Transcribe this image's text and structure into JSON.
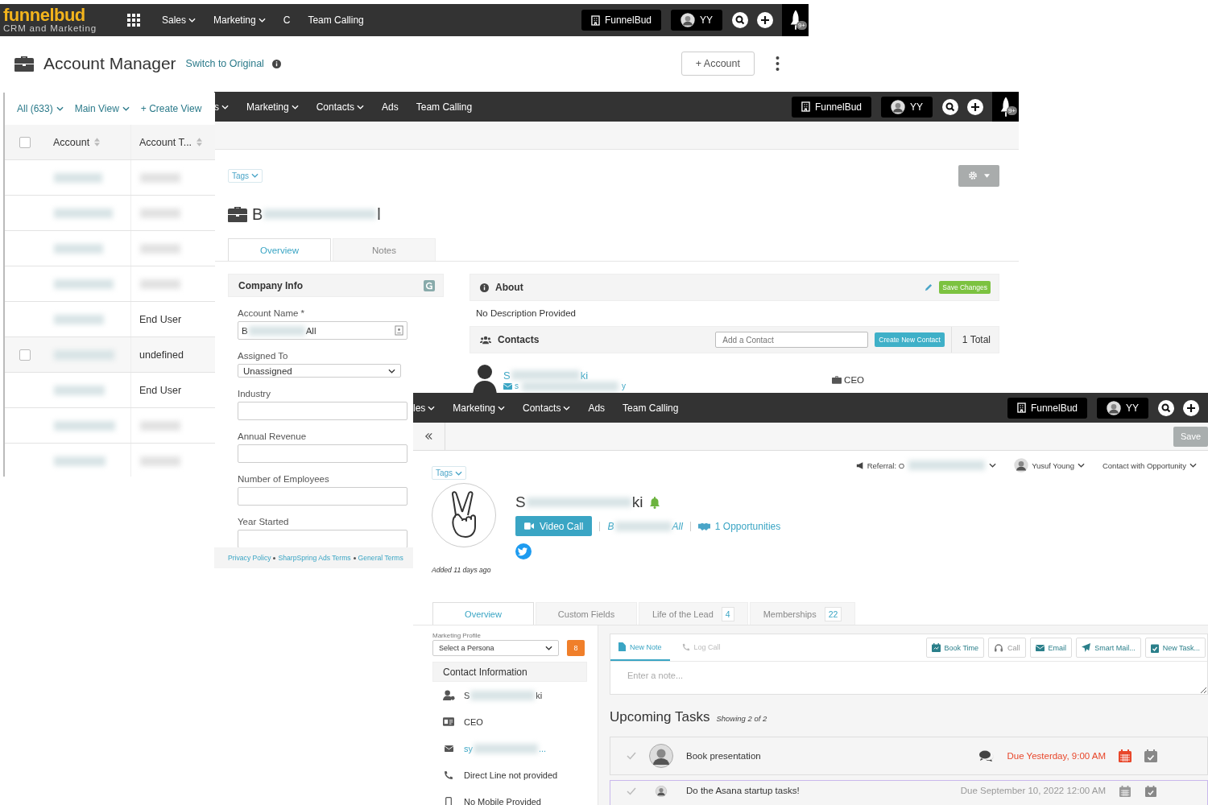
{
  "back_window": {
    "logo": {
      "name": "funnelbud",
      "tagline": "CRM and Marketing"
    },
    "nav": [
      {
        "label": "Sales",
        "dropdown": true
      },
      {
        "label": "Marketing",
        "dropdown": true
      },
      {
        "label": "C",
        "dropdown": false
      },
      {
        "label": "Team Calling",
        "dropdown": false
      }
    ],
    "org_button": "FunnelBud",
    "user_button": "YY",
    "notification_badge": "9+",
    "header": {
      "title": "Account Manager",
      "switch_link": "Switch to Original",
      "add_button": "+ Account"
    },
    "list": {
      "filters": [
        {
          "label": "All (633)",
          "dropdown": true
        },
        {
          "label": "Main View",
          "dropdown": true
        },
        {
          "label": "+ Create View",
          "dropdown": false
        }
      ],
      "select_all_checked": false,
      "columns": [
        "Account",
        "Account T..."
      ],
      "rows": [
        {
          "hovered": false
        },
        {
          "hovered": false
        },
        {
          "hovered": false
        },
        {
          "hovered": false
        },
        {
          "hovered": false,
          "type": "End User"
        },
        {
          "hovered": true,
          "checked": false,
          "type": "undefined"
        },
        {
          "hovered": false,
          "type": "End User"
        },
        {
          "hovered": false
        },
        {
          "hovered": false
        }
      ]
    }
  },
  "account_window": {
    "nav": [
      {
        "label": "s",
        "dropdown": true
      },
      {
        "label": "Marketing",
        "dropdown": true
      },
      {
        "label": "Contacts",
        "dropdown": true
      },
      {
        "label": "Ads",
        "dropdown": false
      },
      {
        "label": "Team Calling",
        "dropdown": false
      }
    ],
    "org_button": "FunnelBud",
    "user_button": "YY",
    "notification_badge": "9+",
    "tags": "Tags",
    "title": {
      "start": "B",
      "end": "l"
    },
    "tabs": [
      {
        "label": "Overview",
        "selected": true
      },
      {
        "label": "Notes",
        "selected": false
      }
    ],
    "company_info": {
      "heading": "Company Info",
      "fields": [
        {
          "kind": "text",
          "label": "Account Name *",
          "value_start": "B",
          "value_end": "All"
        },
        {
          "kind": "select",
          "label": "Assigned To",
          "value": "Unassigned"
        },
        {
          "kind": "text",
          "label": "Industry"
        },
        {
          "kind": "text",
          "label": "Annual Revenue"
        },
        {
          "kind": "text",
          "label": "Number of Employees"
        },
        {
          "kind": "text",
          "label": "Year Started"
        }
      ]
    },
    "about": {
      "heading": "About",
      "save_button": "Save Changes",
      "description": "No Description Provided"
    },
    "contacts": {
      "heading": "Contacts",
      "add_placeholder": "Add a Contact",
      "create_button": "Create New Contact",
      "total": "1 Total",
      "items": [
        {
          "name_start": "S",
          "name_end": "ki",
          "email_start": "s",
          "email_end": "y",
          "title": "CEO"
        }
      ]
    },
    "footer": [
      "Privacy Policy",
      "SharpSpring Ads Terms",
      "General Terms"
    ]
  },
  "contact_window": {
    "nav": [
      {
        "label": "les",
        "dropdown": true
      },
      {
        "label": "Marketing",
        "dropdown": true
      },
      {
        "label": "Contacts",
        "dropdown": true
      },
      {
        "label": "Ads",
        "dropdown": false
      },
      {
        "label": "Team Calling",
        "dropdown": false
      }
    ],
    "org_button": "FunnelBud",
    "user_button": "YY",
    "save_button": "Save",
    "tags": "Tags",
    "meta": [
      {
        "kind": "referral",
        "start": "Referral: O"
      },
      {
        "kind": "owner",
        "label": "Yusuf Young"
      },
      {
        "kind": "status",
        "label": "Contact with Opportunity"
      }
    ],
    "name": {
      "start": "S",
      "end": "ki"
    },
    "video_call": "Video Call",
    "account_link": {
      "start": "B",
      "end": "All"
    },
    "opportunities": "1 Opportunities",
    "added": "Added 11 days ago",
    "tabs": [
      {
        "label": "Overview",
        "selected": true
      },
      {
        "label": "Custom Fields",
        "selected": false
      },
      {
        "label": "Life of the Lead",
        "selected": false,
        "count": "4"
      },
      {
        "label": "Memberships",
        "selected": false,
        "count": "22"
      }
    ],
    "marketing_profile": {
      "label": "Marketing Profile",
      "persona": "Select a Persona",
      "score": "8"
    },
    "contact_info": {
      "heading": "Contact Information",
      "rows": [
        {
          "kind": "name",
          "start": "S",
          "end": "ki"
        },
        {
          "kind": "title",
          "text": "CEO"
        },
        {
          "kind": "email",
          "start": "sy",
          "end": "..."
        },
        {
          "kind": "phone",
          "text": "Direct Line not provided"
        },
        {
          "kind": "mobile",
          "text": "No Mobile Provided"
        }
      ]
    },
    "note_tabs": [
      {
        "label": "New Note",
        "selected": true
      },
      {
        "label": "Log Call",
        "selected": false
      }
    ],
    "actions": [
      {
        "kind": "book",
        "label": "Book Time"
      },
      {
        "kind": "call",
        "label": "Call"
      },
      {
        "kind": "email",
        "label": "Email"
      },
      {
        "kind": "smart",
        "label": "Smart Mail..."
      },
      {
        "kind": "task",
        "label": "New Task..."
      }
    ],
    "note_placeholder": "Enter a note...",
    "tasks": {
      "heading": "Upcoming Tasks",
      "showing": "Showing 2 of 2",
      "items": [
        {
          "title": "Book presentation",
          "due": "Due Yesterday, 9:00 AM",
          "overdue": true,
          "comments": true
        },
        {
          "title": "Do the Asana startup tasks!",
          "due": "Due September 10, 2022 12:00 AM",
          "overdue": false,
          "comments": false
        }
      ]
    }
  }
}
